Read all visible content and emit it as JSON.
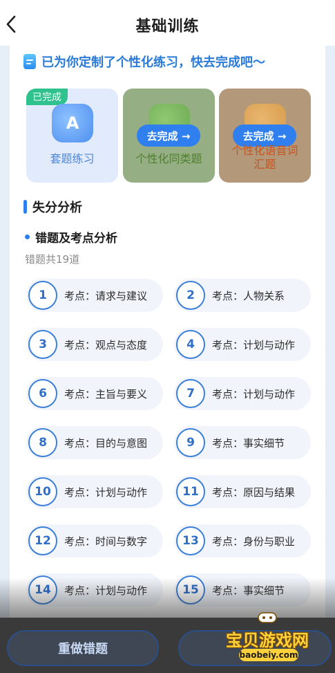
{
  "header": {
    "title": "基础训练"
  },
  "banner": {
    "text": "已为你定制了个性化练习，快去完成吧～"
  },
  "cards": {
    "done": {
      "badge": "已完成",
      "art_letter": "A",
      "label": "套题练习"
    },
    "similar": {
      "button": "去完成 →",
      "label": "个性化同类题"
    },
    "vocab": {
      "button": "去完成 →",
      "label_line1": "个性化语音词",
      "label_line2": "汇题"
    }
  },
  "analysis": {
    "section_title": "失分分析",
    "sub_title": "错题及考点分析",
    "wrong_count": "错题共19道",
    "items": [
      {
        "num": "1",
        "text": "考点：请求与建议"
      },
      {
        "num": "2",
        "text": "考点：人物关系"
      },
      {
        "num": "3",
        "text": "考点：观点与态度"
      },
      {
        "num": "4",
        "text": "考点：计划与动作"
      },
      {
        "num": "6",
        "text": "考点：主旨与要义"
      },
      {
        "num": "7",
        "text": "考点：计划与动作"
      },
      {
        "num": "8",
        "text": "考点：目的与意图"
      },
      {
        "num": "9",
        "text": "考点：事实细节"
      },
      {
        "num": "10",
        "text": "考点：计划与动作"
      },
      {
        "num": "11",
        "text": "考点：原因与结果"
      },
      {
        "num": "12",
        "text": "考点：时间与数字"
      },
      {
        "num": "13",
        "text": "考点：身份与职业"
      },
      {
        "num": "14",
        "text": "考点：计划与动作"
      },
      {
        "num": "15",
        "text": "考点：事实细节"
      }
    ]
  },
  "bottom": {
    "redo_label": "重做错题"
  },
  "watermark": {
    "text": "宝贝游戏网",
    "url": "baobeiy.com"
  },
  "colors": {
    "accent": "#2f7fee",
    "done_badge": "#2fc28f",
    "banner_text": "#2a7ad8"
  }
}
